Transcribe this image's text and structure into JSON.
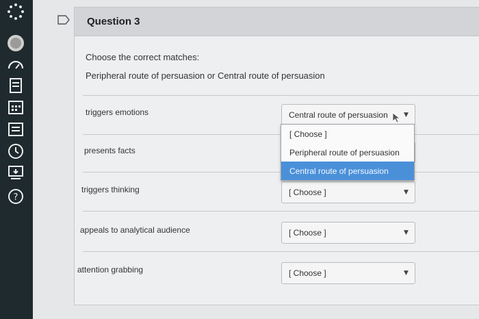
{
  "sidebar": {
    "icons": [
      {
        "name": "loading-dots-icon"
      },
      {
        "name": "avatar-icon"
      },
      {
        "name": "dashboard-icon"
      },
      {
        "name": "courses-icon"
      },
      {
        "name": "calendar-icon"
      },
      {
        "name": "inbox-icon"
      },
      {
        "name": "history-icon"
      },
      {
        "name": "commons-icon"
      },
      {
        "name": "help-icon"
      }
    ]
  },
  "question": {
    "title": "Question 3",
    "instruction": "Choose the correct matches:",
    "options_prompt": "Peripheral route of persuasion or Central route of persuasion"
  },
  "rows": [
    {
      "label": "triggers emotions",
      "value": "Central route of persuasion"
    },
    {
      "label": "presents facts",
      "value": ""
    },
    {
      "label": "triggers thinking",
      "value": "[ Choose ]"
    },
    {
      "label": "appeals to analytical audience",
      "value": "[ Choose ]"
    },
    {
      "label": "attention grabbing",
      "value": "[ Choose ]"
    }
  ],
  "dropdown": {
    "options": [
      "[ Choose ]",
      "Peripheral route of persuasion",
      "Central route of persuasion"
    ],
    "selected_index": 2
  },
  "colors": {
    "rail": "#1e2a2e",
    "header": "#d2d4d8",
    "highlight": "#4a90d9"
  }
}
